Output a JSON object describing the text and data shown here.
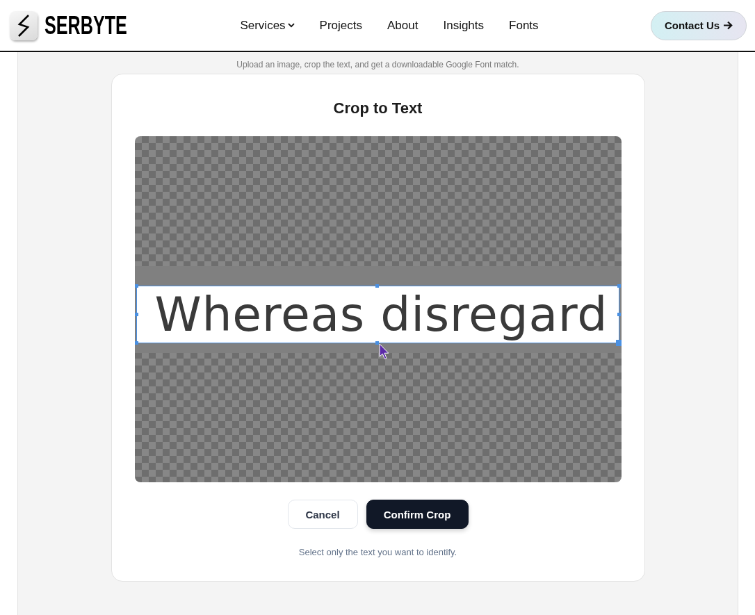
{
  "header": {
    "logo": {
      "text": "SERBYTE"
    },
    "nav": [
      {
        "label": "Services",
        "dropdown": true
      },
      {
        "label": "Projects",
        "dropdown": false
      },
      {
        "label": "About",
        "dropdown": false
      },
      {
        "label": "Insights",
        "dropdown": false
      },
      {
        "label": "Fonts",
        "dropdown": false
      }
    ],
    "contact_button": {
      "label": "Contact Us"
    }
  },
  "subtitle": "Upload an image, crop the text, and get a downloadable Google Font match.",
  "crop_dialog": {
    "title": "Crop to Text",
    "image_text": "Whereas disregard",
    "buttons": [
      {
        "label": "Cancel",
        "kind": "secondary"
      },
      {
        "label": "Confirm Crop",
        "kind": "primary"
      }
    ],
    "hint": "Select only the text you want to identify."
  }
}
